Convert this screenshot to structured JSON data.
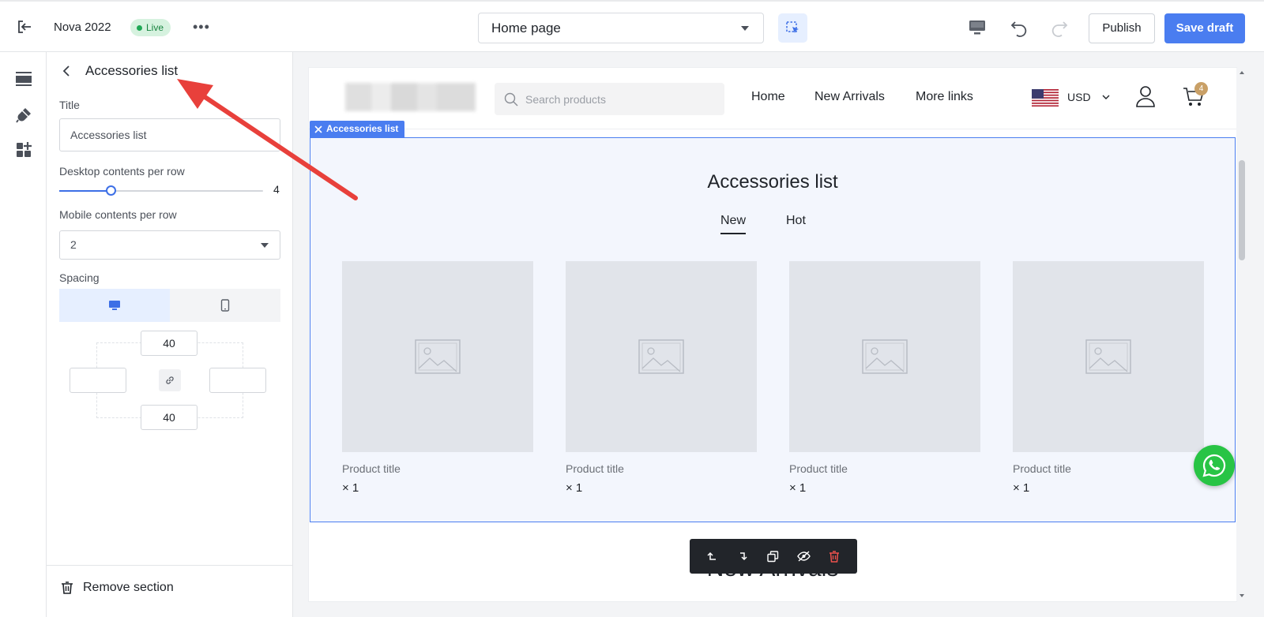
{
  "topbar": {
    "store_name": "Nova 2022",
    "status": "Live",
    "more": "•••",
    "page_select": "Home page",
    "publish_label": "Publish",
    "save_draft_label": "Save draft"
  },
  "rail": {
    "icons": [
      "sections-icon",
      "theme-style-icon",
      "apps-icon"
    ]
  },
  "panel": {
    "title": "Accessories list",
    "title_label": "Title",
    "title_value": "Accessories list",
    "desktop_label": "Desktop contents per row",
    "desktop_value": "4",
    "desktop_slider_fraction": 0.25,
    "mobile_label": "Mobile contents per row",
    "mobile_value": "2",
    "spacing_label": "Spacing",
    "spacing": {
      "top": "40",
      "bottom": "40",
      "left": "",
      "right": ""
    },
    "remove_label": "Remove section"
  },
  "preview": {
    "search_placeholder": "Search products",
    "nav": [
      "Home",
      "New Arrivals",
      "More links"
    ],
    "currency": "USD",
    "cart_count": "4",
    "section_tag": "Accessories list",
    "section_heading": "Accessories list",
    "tabs": [
      "New",
      "Hot"
    ],
    "products": [
      {
        "title": "Product title",
        "qty": "× 1"
      },
      {
        "title": "Product title",
        "qty": "× 1"
      },
      {
        "title": "Product title",
        "qty": "× 1"
      },
      {
        "title": "Product title",
        "qty": "× 1"
      }
    ],
    "next_heading": "New Arrivals"
  },
  "colors": {
    "accent": "#4a7df0",
    "live_bg": "#d6f2df",
    "live_text": "#17833f",
    "annotation_arrow": "#e8403b",
    "whatsapp": "#28c445"
  }
}
